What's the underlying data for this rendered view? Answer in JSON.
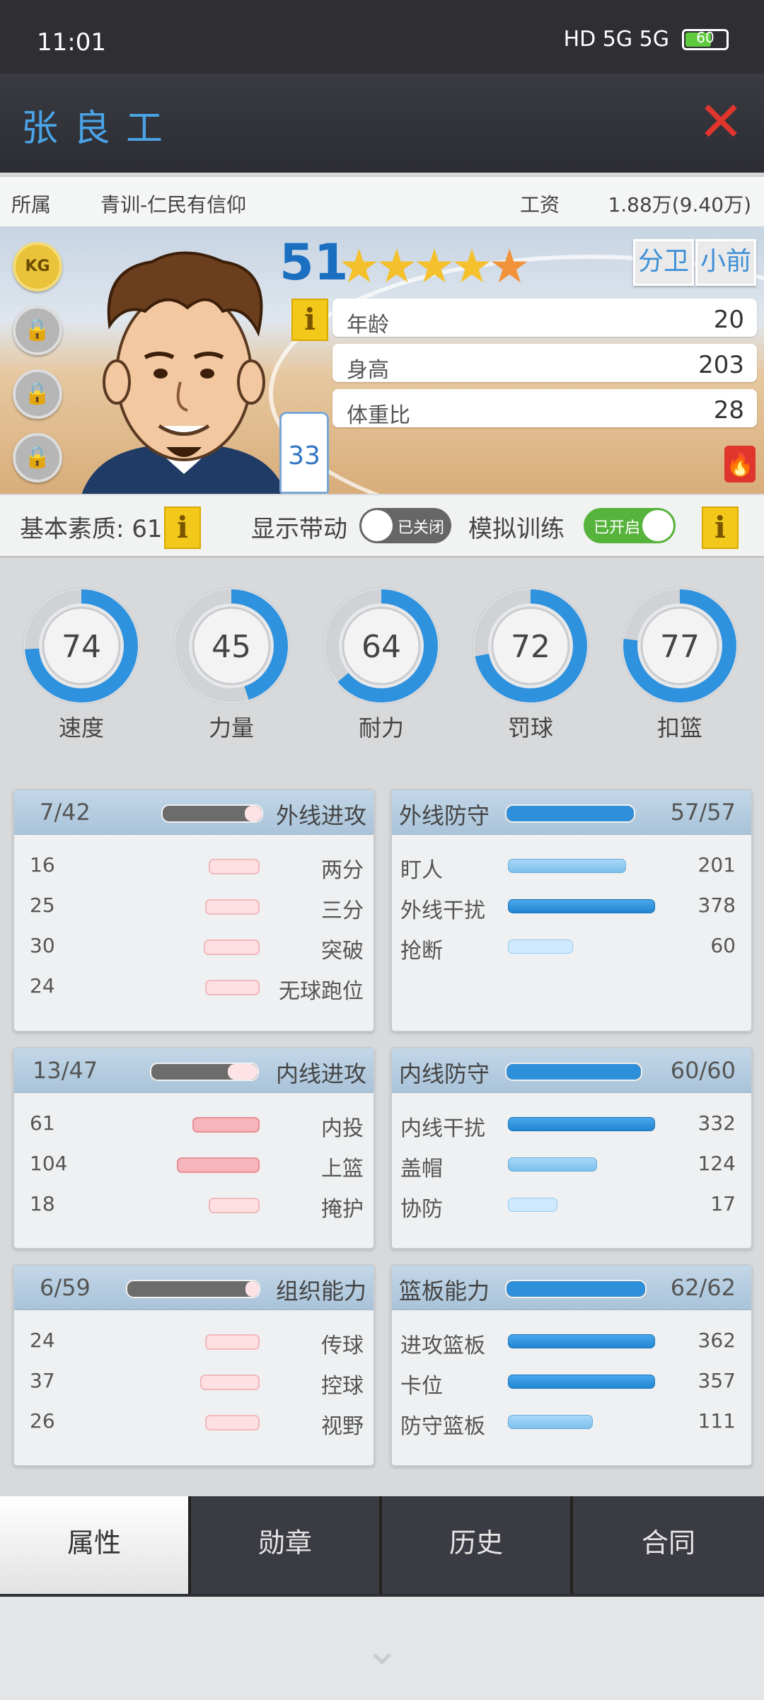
{
  "status": {
    "time": "11:01",
    "network": "HD 5G 5G",
    "battery": "60"
  },
  "header": {
    "player_name": "张良工"
  },
  "info": {
    "team_label": "所属",
    "team_value": "青训-仁民有信仰",
    "salary_label": "工资",
    "salary_value": "1.88万(9.40万)"
  },
  "player": {
    "badge": "KG",
    "rating": "51",
    "stars_full": 4,
    "stars_half": true,
    "stars_total": 5,
    "positions": [
      "分卫",
      "小前"
    ],
    "jersey_number": "33",
    "attributes": [
      {
        "label": "年龄",
        "value": "20"
      },
      {
        "label": "身高",
        "value": "203"
      },
      {
        "label": "体重比",
        "value": "28"
      }
    ]
  },
  "toggles": {
    "base_quality": "基本素质: 61",
    "show_drive_label": "显示带动",
    "show_drive_state": "已关闭",
    "sim_training_label": "模拟训练",
    "sim_training_state": "已开启"
  },
  "gauges": [
    {
      "label": "速度",
      "value": 74
    },
    {
      "label": "力量",
      "value": 45
    },
    {
      "label": "耐力",
      "value": 64
    },
    {
      "label": "罚球",
      "value": 72
    },
    {
      "label": "扣篮",
      "value": 77
    }
  ],
  "panels": {
    "outside_attack": {
      "count": "7/42",
      "title": "外线进攻",
      "fill": 0.17,
      "rows": [
        {
          "value": "16",
          "label": "两分"
        },
        {
          "value": "25",
          "label": "三分"
        },
        {
          "value": "30",
          "label": "突破"
        },
        {
          "value": "24",
          "label": "无球跑位"
        }
      ]
    },
    "outside_defense": {
      "count": "57/57",
      "title": "外线防守",
      "fill": 1.0,
      "rows": [
        {
          "value": "201",
          "label": "盯人"
        },
        {
          "value": "378",
          "label": "外线干扰"
        },
        {
          "value": "60",
          "label": "抢断"
        }
      ]
    },
    "inside_attack": {
      "count": "13/47",
      "title": "内线进攻",
      "fill": 0.28,
      "rows": [
        {
          "value": "61",
          "label": "内投"
        },
        {
          "value": "104",
          "label": "上篮"
        },
        {
          "value": "18",
          "label": "掩护"
        }
      ]
    },
    "inside_defense": {
      "count": "60/60",
      "title": "内线防守",
      "fill": 1.0,
      "rows": [
        {
          "value": "332",
          "label": "内线干扰"
        },
        {
          "value": "124",
          "label": "盖帽"
        },
        {
          "value": "17",
          "label": "协防"
        }
      ]
    },
    "playmaking": {
      "count": "6/59",
      "title": "组织能力",
      "fill": 0.1,
      "rows": [
        {
          "value": "24",
          "label": "传球"
        },
        {
          "value": "37",
          "label": "控球"
        },
        {
          "value": "26",
          "label": "视野"
        }
      ]
    },
    "rebounding": {
      "count": "62/62",
      "title": "篮板能力",
      "fill": 1.0,
      "rows": [
        {
          "value": "362",
          "label": "进攻篮板"
        },
        {
          "value": "357",
          "label": "卡位"
        },
        {
          "value": "111",
          "label": "防守篮板"
        }
      ]
    }
  },
  "tabs": [
    {
      "label": "属性",
      "active": true
    },
    {
      "label": "勋章",
      "active": false
    },
    {
      "label": "历史",
      "active": false
    },
    {
      "label": "合同",
      "active": false
    }
  ],
  "colors": {
    "accent_blue": "#2186d2",
    "close_red": "#e0352d",
    "switch_on": "#56b33b"
  }
}
